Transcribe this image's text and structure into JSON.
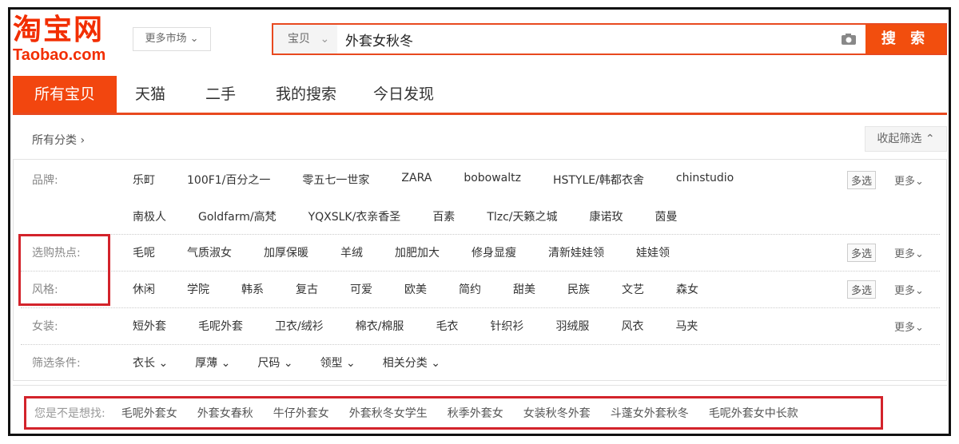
{
  "logo": {
    "cn": "淘宝网",
    "en": "Taobao.com"
  },
  "market_select": "更多市场 ⌄",
  "search": {
    "category": "宝贝",
    "category_arrow": "⌄",
    "query": "外套女秋冬",
    "button": "搜 索"
  },
  "tabs": [
    "所有宝贝",
    "天猫",
    "二手",
    "我的搜索",
    "今日发现"
  ],
  "breadcrumb": "所有分类 ›",
  "collapse_filter": "收起筛选 ⌃",
  "filters": {
    "brand": {
      "label": "品牌:",
      "row1": [
        "乐町",
        "100F1/百分之一",
        "零五七一世家",
        "ZARA",
        "bobowaltz",
        "HSTYLE/韩都衣舍",
        "chinstudio"
      ],
      "row2": [
        "南极人",
        "Goldfarm/高梵",
        "YQXSLK/衣亲香圣",
        "百素",
        "Tlzc/天籁之城",
        "康诺玫",
        "茵曼"
      ]
    },
    "hot": {
      "label": "选购热点:",
      "items": [
        "毛呢",
        "气质淑女",
        "加厚保暖",
        "羊绒",
        "加肥加大",
        "修身显瘦",
        "清新娃娃领",
        "娃娃领"
      ]
    },
    "style": {
      "label": "风格:",
      "items": [
        "休闲",
        "学院",
        "韩系",
        "复古",
        "可爱",
        "欧美",
        "简约",
        "甜美",
        "民族",
        "文艺",
        "森女"
      ]
    },
    "women": {
      "label": "女装:",
      "items": [
        "短外套",
        "毛呢外套",
        "卫衣/绒衫",
        "棉衣/棉服",
        "毛衣",
        "针织衫",
        "羽绒服",
        "风衣",
        "马夹"
      ]
    },
    "conditions": {
      "label": "筛选条件:",
      "items": [
        "衣长 ⌄",
        "厚薄 ⌄",
        "尺码 ⌄",
        "领型 ⌄",
        "相关分类 ⌄"
      ]
    },
    "multi": "多选",
    "more": "更多⌄"
  },
  "suggestions": {
    "label": "您是不是想找:",
    "items": [
      "毛呢外套女",
      "外套女春秋",
      "牛仔外套女",
      "外套秋冬女学生",
      "秋季外套女",
      "女装秋冬外套",
      "斗蓬女外套秋冬",
      "毛呢外套女中长款"
    ]
  }
}
